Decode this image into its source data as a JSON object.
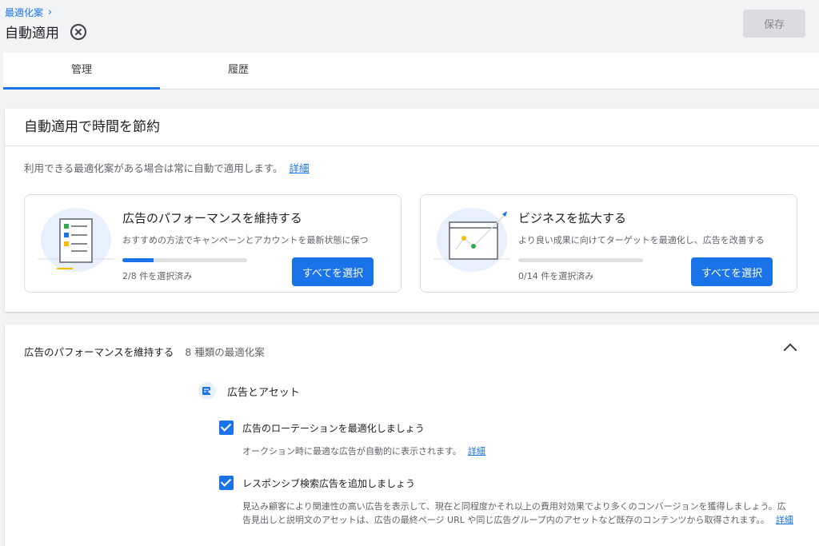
{
  "header": {
    "breadcrumb": "最適化案",
    "title": "自動適用",
    "save_label": "保存"
  },
  "tabs": [
    {
      "label": "管理",
      "active": true
    },
    {
      "label": "履歴",
      "active": false
    }
  ],
  "auto_apply_card": {
    "title": "自動適用で時間を節約",
    "description": "利用できる最適化案がある場合は常に自動で適用します。",
    "learn_more": "詳細",
    "options": [
      {
        "title": "広告のパフォーマンスを維持する",
        "description": "おすすめの方法でキャンペーンとアカウントを最新状態に保つ",
        "selected_text": "2/8 件を選択済み",
        "progress": 0.25,
        "button": "すべてを選択"
      },
      {
        "title": "ビジネスを拡大する",
        "description": "より良い成果に向けてターゲットを最適化し、広告を改善する",
        "selected_text": "0/14 件を選択済み",
        "progress": 0,
        "button": "すべてを選択"
      }
    ]
  },
  "section": {
    "title": "広告のパフォーマンスを維持する",
    "count": "8 種類の最適化案",
    "category": "広告とアセット",
    "items": [
      {
        "title": "広告のローテーションを最適化しましょう",
        "description": "オークション時に最適な広告が自動的に表示されます。",
        "link": "詳細",
        "checked": true
      },
      {
        "title": "レスポンシブ検索広告を追加しましょう",
        "description": "見込み顧客により関連性の高い広告を表示して、現在と同程度かそれ以上の費用対効果でより多くのコンバージョンを獲得しましょう。広告見出しと説明文のアセットは、広告の最終ページ URL や同じ広告グループ内のアセットなど既存のコンテンツから取得されます。。",
        "link": "詳細",
        "checked": true
      }
    ]
  },
  "colors": {
    "accent": "#1a73e8",
    "background": "#f1f3f4"
  }
}
